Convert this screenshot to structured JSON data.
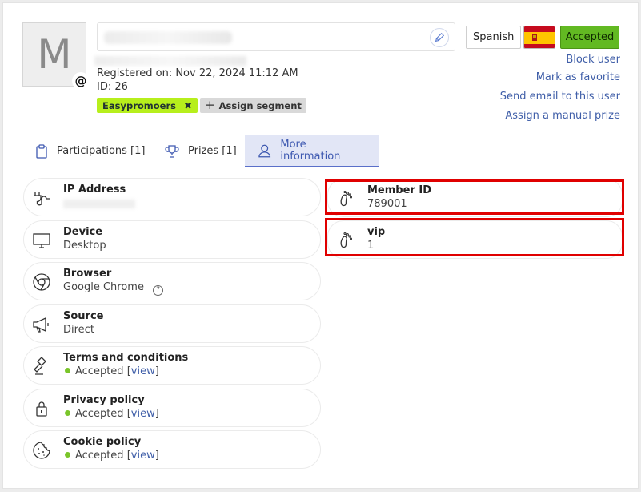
{
  "user": {
    "avatar_letter": "M",
    "registered": "Registered on: Nov 22, 2024 11:12 AM",
    "id": "ID: 26"
  },
  "segments": {
    "tag": "Easypromoers",
    "assign_label": "Assign segment"
  },
  "header": {
    "language": "Spanish",
    "status": "Accepted"
  },
  "actions": [
    "Block user",
    "Mark as favorite",
    "Send email to this user",
    "Assign a manual prize"
  ],
  "tabs": [
    {
      "label": "Participations [1]"
    },
    {
      "label": "Prizes [1]"
    },
    {
      "label": "More information"
    }
  ],
  "info": {
    "ip": {
      "label": "IP Address"
    },
    "device": {
      "label": "Device",
      "value": "Desktop"
    },
    "browser": {
      "label": "Browser",
      "value": "Google Chrome"
    },
    "source": {
      "label": "Source",
      "value": "Direct"
    },
    "terms": {
      "label": "Terms and conditions",
      "status": "Accepted",
      "link": "view"
    },
    "privacy": {
      "label": "Privacy policy",
      "status": "Accepted",
      "link": "view"
    },
    "cookie": {
      "label": "Cookie policy",
      "status": "Accepted",
      "link": "view"
    }
  },
  "custom": [
    {
      "label": "Member ID",
      "value": "789001"
    },
    {
      "label": "vip",
      "value": "1"
    }
  ],
  "colors": {
    "accent": "#3d58b0",
    "accepted": "#62b922",
    "segment": "#b7ef1c",
    "highlight": "#e00000"
  }
}
